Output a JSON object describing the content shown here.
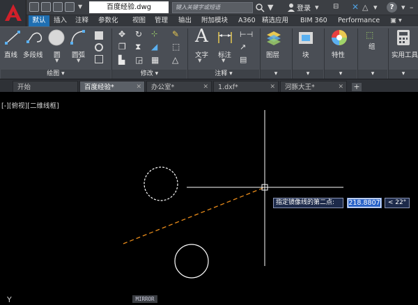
{
  "titlebar": {
    "filename": "百度经验.dwg",
    "search_placeholder": "键入关键字或短语",
    "login_label": "登录"
  },
  "ribbon_tabs": [
    {
      "label": "默认",
      "active": true
    },
    {
      "label": "插入"
    },
    {
      "label": "注释"
    },
    {
      "label": "参数化"
    },
    {
      "label": "视图"
    },
    {
      "label": "管理"
    },
    {
      "label": "输出"
    },
    {
      "label": "附加模块"
    },
    {
      "label": "A360"
    },
    {
      "label": "精选应用"
    },
    {
      "label": "BIM 360"
    },
    {
      "label": "Performance"
    }
  ],
  "ribbon": {
    "tools": {
      "line": "直线",
      "polyline": "多段线",
      "circle": "圆",
      "arc": "圆弧",
      "text": "文字",
      "dimension": "标注",
      "layers": "图层",
      "block": "块",
      "properties": "特性",
      "group": "组",
      "utilities": "实用工具"
    },
    "panels": {
      "draw": "绘图",
      "modify": "修改",
      "annotation": "注释"
    }
  },
  "doc_tabs": [
    {
      "label": "开始"
    },
    {
      "label": "百度经验*",
      "active": true
    },
    {
      "label": "办公室*"
    },
    {
      "label": "1.dxf*"
    },
    {
      "label": "河豚大王*"
    }
  ],
  "canvas": {
    "viewport_label": "[-][俯视][二维线框]",
    "prompt": "指定镜像线的第二点:",
    "input_value": "218.8807",
    "angle": "< 22°",
    "command": "MIRROR"
  },
  "colors": {
    "accent": "#1f6fb2",
    "mirror_line": "#e88b1a",
    "canvas_bg": "#000000"
  }
}
